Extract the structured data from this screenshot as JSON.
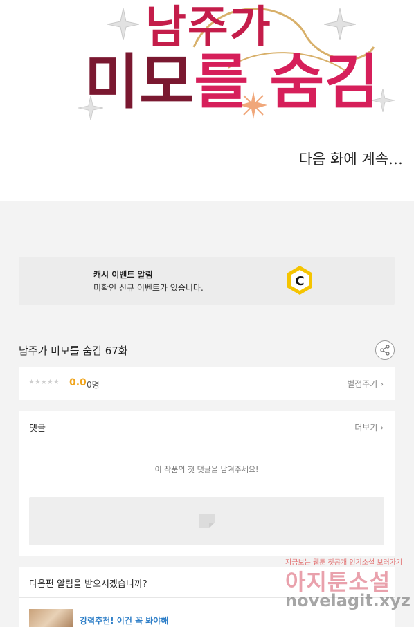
{
  "comic": {
    "title_line1": "남주가",
    "title_line2_a": "미모",
    "title_line2_b": "를 숨김",
    "continue_text": "다음 화에 계속…"
  },
  "cash_banner": {
    "title": "캐시 이벤트 알림",
    "description": "미확인 신규 이벤트가 있습니다.",
    "icon": "cash-c-icon",
    "icon_color": "#f5c400"
  },
  "episode": {
    "title": "남주가 미모를 숨김 67화",
    "share_icon": "share-icon"
  },
  "rating": {
    "stars": "★★★★★",
    "value": "0.0",
    "count": "0명",
    "rate_link": "별점주기"
  },
  "comments": {
    "title": "댓글",
    "more_link": "더보기",
    "empty_text": "이 작품의 첫 댓글을 남겨주세요!"
  },
  "notification": {
    "title": "다음편 알림을 받으시겠습니까?",
    "recommend_text": "강력추천! 이건 꼭 봐야해"
  },
  "watermark": {
    "top": "지금보는 웹툰 첫공개 인기소설 보러가기",
    "mid": "아지툰소설",
    "bottom": "novelagit.xyz"
  },
  "colors": {
    "accent_orange": "#f0a41b",
    "link_blue": "#2f7fc8",
    "title_crimson": "#c41d4a"
  }
}
